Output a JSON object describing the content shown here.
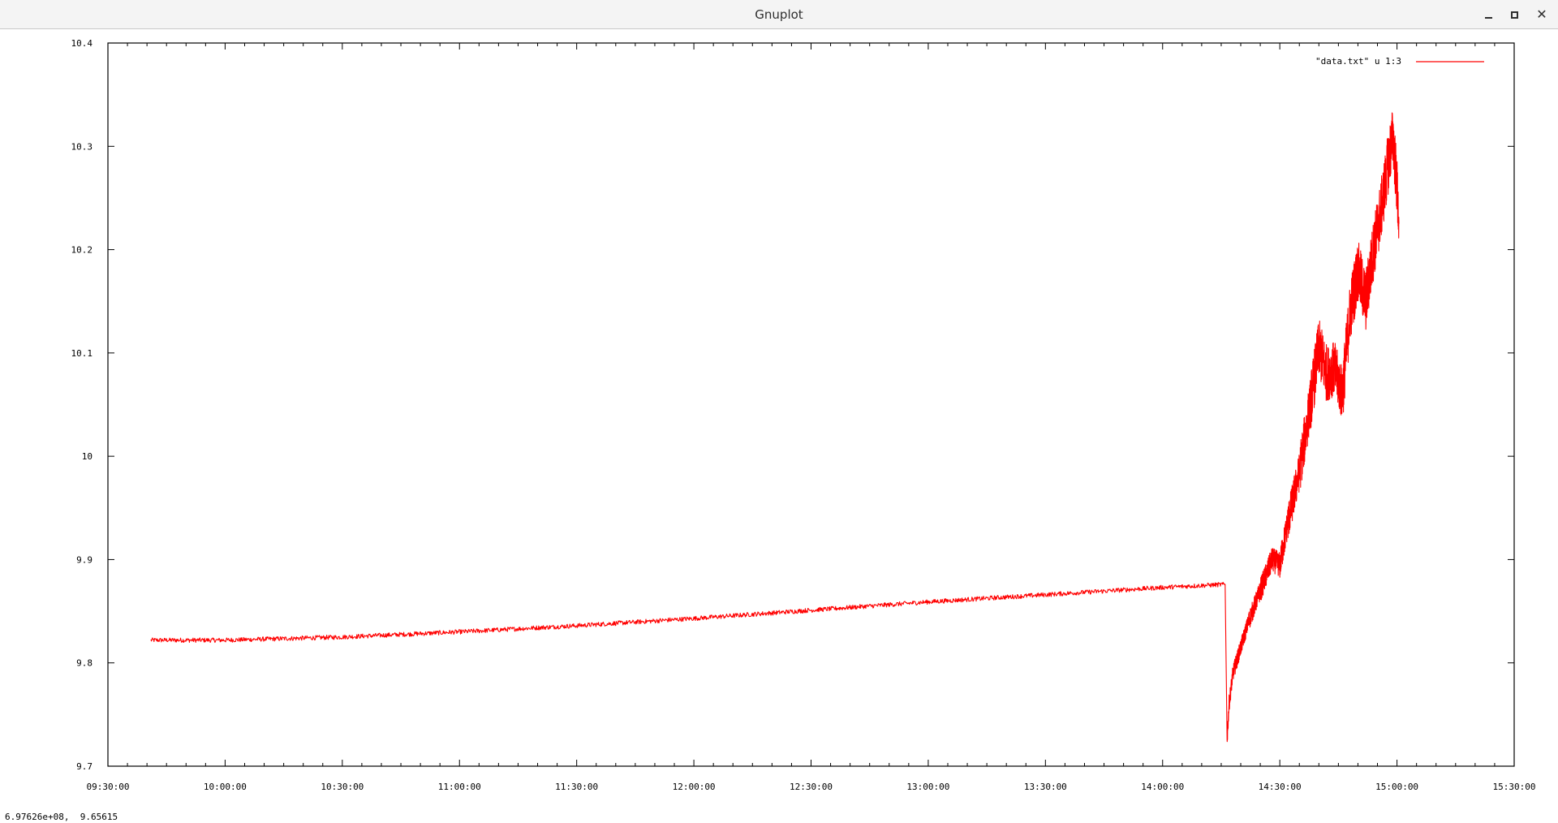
{
  "window": {
    "title": "Gnuplot",
    "minimize_icon": "minimize-icon",
    "maximize_icon": "maximize-icon",
    "close_icon": "close-icon"
  },
  "status_bar": {
    "mouse_readout": "6.97626e+08,  9.65615"
  },
  "chart_data": {
    "type": "line",
    "title": "",
    "xlabel": "",
    "ylabel": "",
    "x_ticks": [
      "09:30:00",
      "10:00:00",
      "10:30:00",
      "11:00:00",
      "11:30:00",
      "12:00:00",
      "12:30:00",
      "13:00:00",
      "13:30:00",
      "14:00:00",
      "14:30:00",
      "15:00:00",
      "15:30:00"
    ],
    "y_ticks": [
      "9.7",
      "9.8",
      "9.9",
      "10",
      "10.1",
      "10.2",
      "10.3",
      "10.4"
    ],
    "xlim": [
      "09:30:00",
      "15:30:00"
    ],
    "ylim": [
      9.7,
      10.4
    ],
    "grid": false,
    "legend": "top-right",
    "series": [
      {
        "name": "\"data.txt\" u 1:3",
        "color": "#ff0000",
        "x": [
          "09:41:00",
          "10:00:00",
          "10:30:00",
          "11:00:00",
          "11:30:00",
          "12:00:00",
          "12:30:00",
          "13:00:00",
          "13:30:00",
          "14:00:00",
          "14:16:00",
          "14:16:30",
          "14:17:00",
          "14:18:00",
          "14:20:00",
          "14:22:00",
          "14:25:00",
          "14:28:00",
          "14:30:00",
          "14:32:00",
          "14:35:00",
          "14:38:00",
          "14:40:00",
          "14:42:00",
          "14:44:00",
          "14:46:00",
          "14:48:00",
          "14:50:00",
          "14:52:00",
          "14:54:00",
          "14:56:00",
          "14:58:00",
          "14:59:00",
          "15:00:00",
          "15:00:30"
        ],
        "y": [
          9.822,
          9.822,
          9.825,
          9.83,
          9.836,
          9.843,
          9.851,
          9.859,
          9.866,
          9.873,
          9.876,
          9.725,
          9.76,
          9.79,
          9.815,
          9.84,
          9.87,
          9.9,
          9.895,
          9.935,
          9.985,
          10.055,
          10.105,
          10.08,
          10.085,
          10.06,
          10.14,
          10.18,
          10.15,
          10.2,
          10.24,
          10.29,
          10.31,
          10.26,
          10.225
        ]
      }
    ]
  }
}
